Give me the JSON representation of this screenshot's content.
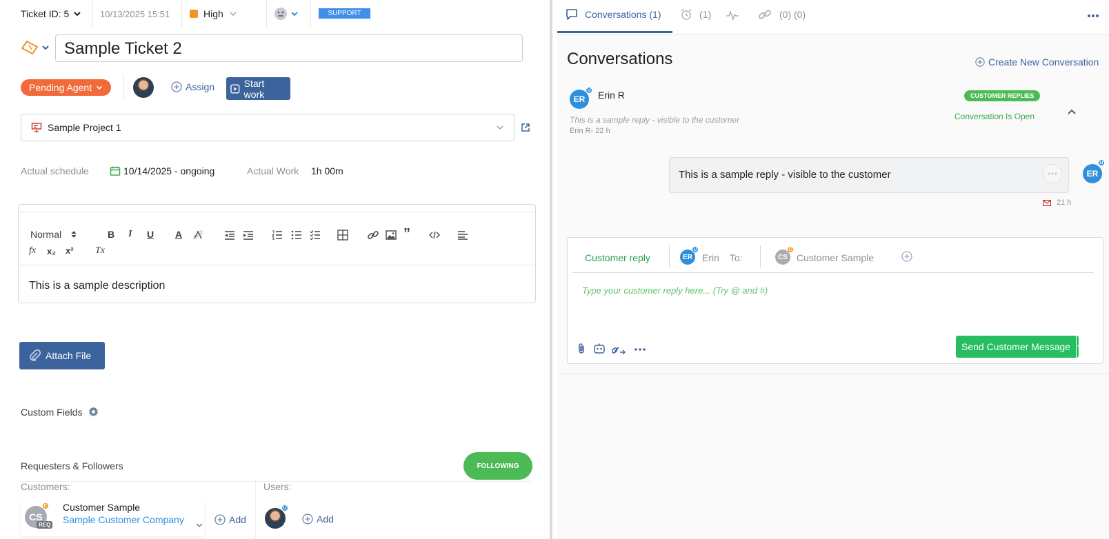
{
  "colors": {
    "accent_blue": "#3c639b",
    "status_orange": "#f26a3a",
    "priority_orange": "#f0952a",
    "green": "#4cbb55",
    "send_green": "#27bd63",
    "support_blue": "#3f8fe8",
    "avatar_blue": "#2f8fdc"
  },
  "topbar": {
    "ticket_id_label": "Ticket ID: 5",
    "created": "10/13/2025 15:51",
    "priority": "High",
    "tag": "SUPPORT"
  },
  "ticket": {
    "title": "Sample Ticket 2",
    "status": "Pending Agent",
    "assign_label": "Assign",
    "start_work_label": "Start work",
    "project": "Sample Project 1",
    "actual_schedule_label": "Actual schedule",
    "actual_schedule_value": "10/14/2025 - ongoing",
    "actual_work_label": "Actual Work",
    "actual_work_value": "1h 00m",
    "description": "This is a sample description"
  },
  "editor": {
    "format_select": "Normal",
    "toolbar_icons": [
      "bold-icon",
      "italic-icon",
      "underline-icon",
      "text-color-icon",
      "background-color-icon",
      "outdent-icon",
      "indent-icon",
      "ordered-list-icon",
      "bullet-list-icon",
      "checklist-icon",
      "table-icon",
      "link-icon",
      "image-icon",
      "quote-icon",
      "code-icon",
      "align-icon",
      "formula-icon",
      "subscript-icon",
      "superscript-icon",
      "clear-format-icon"
    ],
    "bold": "B",
    "italic": "I",
    "underline": "U",
    "text_color": "A",
    "formula": "fx",
    "subscript": "x₂",
    "superscript": "x²",
    "clear": "Tx"
  },
  "attach_file_label": "Attach File",
  "custom_fields_label": "Custom Fields",
  "requesters": {
    "title": "Requesters & Followers",
    "following_label": "FOLLOWING",
    "customers_label": "Customers:",
    "users_label": "Users:",
    "customer_initials": "CS",
    "customer_req_badge": "REQ",
    "customer_name": "Customer Sample",
    "customer_company": "Sample Customer Company",
    "add_label": "Add",
    "users_add_label": "Add"
  },
  "right": {
    "tab_conversations": "Conversations (1)",
    "tab_reminders_count": "(1)",
    "tab_links_count": "(0) (0)",
    "heading": "Conversations",
    "create_new": "Create New Conversation",
    "conversation": {
      "author_initials": "ER",
      "author": "Erin R",
      "preview": "This is a sample reply - visible to the customer",
      "meta": "Erin R- 22 h",
      "badge": "CUSTOMER REPLIES",
      "state": "Conversation Is Open"
    },
    "message": {
      "text": "This is a sample reply - visible to the customer",
      "time": "21 h",
      "initials": "ER"
    },
    "reply": {
      "tab": "Customer reply",
      "from_initials": "ER",
      "from_name": "Erin",
      "to_label": "To:",
      "to_initials": "CS",
      "to_name": "Customer Sample",
      "placeholder": "Type your customer reply here... (Try @ and #)",
      "send_label": "Send Customer Message"
    }
  }
}
